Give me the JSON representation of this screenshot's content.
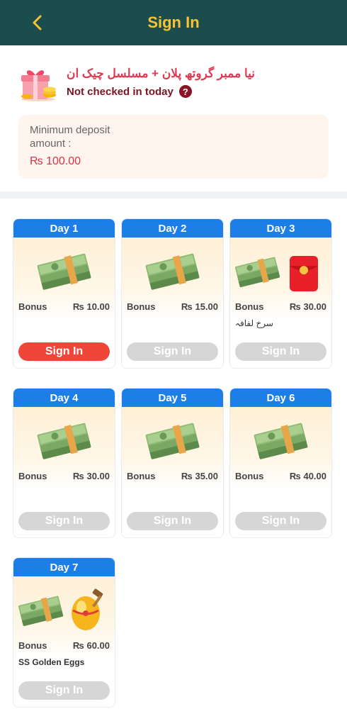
{
  "header": {
    "title": "Sign In"
  },
  "promo": {
    "title": "نیا ممبر گروتھ پلان + مسلسل چیک ان",
    "status": "Not checked in today",
    "help_symbol": "?",
    "deposit_label": "Minimum deposit amount :",
    "deposit_value": "₨ 100.00"
  },
  "days": [
    {
      "label": "Day 1",
      "bonus_label": "Bonus",
      "amount": "₨ 10.00",
      "extra": "",
      "button": "Sign In",
      "active": true
    },
    {
      "label": "Day 2",
      "bonus_label": "Bonus",
      "amount": "₨ 15.00",
      "extra": "",
      "button": "Sign In",
      "active": false
    },
    {
      "label": "Day 3",
      "bonus_label": "Bonus",
      "amount": "₨ 30.00",
      "extra": "سرخ لفافہ",
      "button": "Sign In",
      "active": false
    },
    {
      "label": "Day 4",
      "bonus_label": "Bonus",
      "amount": "₨ 30.00",
      "extra": "",
      "button": "Sign In",
      "active": false
    },
    {
      "label": "Day 5",
      "bonus_label": "Bonus",
      "amount": "₨ 35.00",
      "extra": "",
      "button": "Sign In",
      "active": false
    },
    {
      "label": "Day 6",
      "bonus_label": "Bonus",
      "amount": "₨ 40.00",
      "extra": "",
      "button": "Sign In",
      "active": false
    },
    {
      "label": "Day 7",
      "bonus_label": "Bonus",
      "amount": "₨ 60.00",
      "extra": "SS Golden Eggs",
      "button": "Sign In",
      "active": false
    }
  ],
  "colors": {
    "header_bg": "#1b4d4f",
    "title": "#f5c431",
    "day_head": "#1e7ee8",
    "active_button": "#f0463a",
    "disabled_button": "#d6d6d6"
  }
}
